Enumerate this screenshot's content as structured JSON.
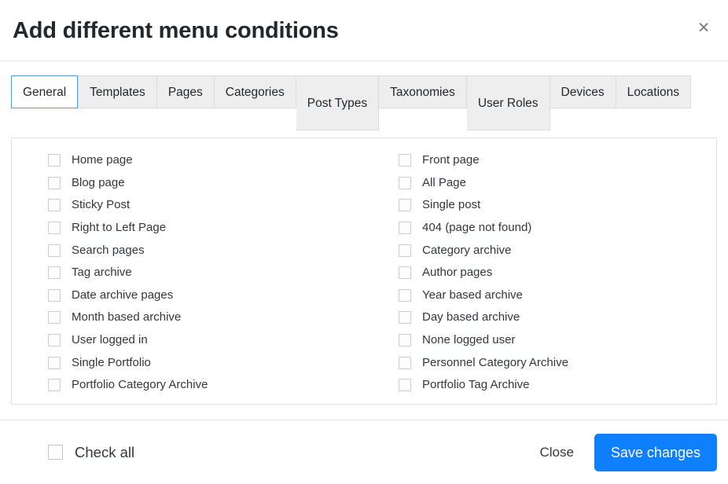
{
  "header": {
    "title": "Add different menu conditions",
    "close_icon": "×"
  },
  "tabs": [
    {
      "label": "General",
      "active": true,
      "two_line": false
    },
    {
      "label": "Templates",
      "active": false,
      "two_line": false
    },
    {
      "label": "Pages",
      "active": false,
      "two_line": false
    },
    {
      "label": "Categories",
      "active": false,
      "two_line": false
    },
    {
      "label": "Post Types",
      "active": false,
      "two_line": true
    },
    {
      "label": "Taxonomies",
      "active": false,
      "two_line": false
    },
    {
      "label": "User Roles",
      "active": false,
      "two_line": true
    },
    {
      "label": "Devices",
      "active": false,
      "two_line": false
    },
    {
      "label": "Locations",
      "active": false,
      "two_line": false
    }
  ],
  "conditions": {
    "left": [
      {
        "label": "Home page",
        "checked": false
      },
      {
        "label": "Blog page",
        "checked": false
      },
      {
        "label": "Sticky Post",
        "checked": false
      },
      {
        "label": "Right to Left Page",
        "checked": false
      },
      {
        "label": "Search pages",
        "checked": false
      },
      {
        "label": "Tag archive",
        "checked": false
      },
      {
        "label": "Date archive pages",
        "checked": false
      },
      {
        "label": "Month based archive",
        "checked": false
      },
      {
        "label": "User logged in",
        "checked": false
      },
      {
        "label": "Single Portfolio",
        "checked": false
      },
      {
        "label": "Portfolio Category Archive",
        "checked": false
      }
    ],
    "right": [
      {
        "label": "Front page",
        "checked": false
      },
      {
        "label": "All Page",
        "checked": false
      },
      {
        "label": "Single post",
        "checked": false
      },
      {
        "label": "404 (page not found)",
        "checked": false
      },
      {
        "label": "Category archive",
        "checked": false
      },
      {
        "label": "Author pages",
        "checked": false
      },
      {
        "label": "Year based archive",
        "checked": false
      },
      {
        "label": "Day based archive",
        "checked": false
      },
      {
        "label": "None logged user",
        "checked": false
      },
      {
        "label": "Personnel Category Archive",
        "checked": false
      },
      {
        "label": "Portfolio Tag Archive",
        "checked": false
      }
    ]
  },
  "footer": {
    "check_all_label": "Check all",
    "check_all_checked": false,
    "close_label": "Close",
    "save_label": "Save changes",
    "save_color": "#0d7fff"
  }
}
